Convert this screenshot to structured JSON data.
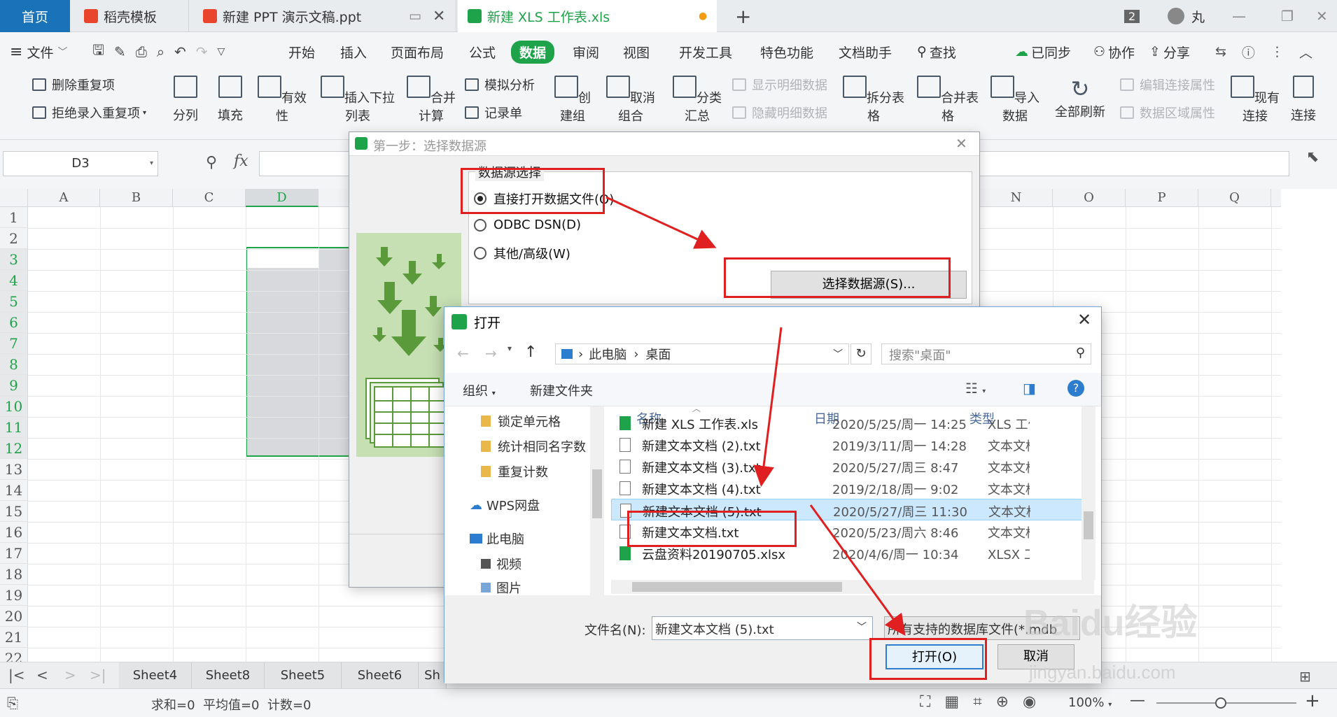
{
  "tabs": [
    {
      "label": "首页",
      "active": true
    },
    {
      "label": "稻壳模板"
    },
    {
      "label": "新建 PPT 演示文稿.ppt"
    },
    {
      "label": "新建 XLS 工作表.xls",
      "current": true
    }
  ],
  "titlebar": {
    "badge": "2",
    "user": "丸"
  },
  "menu": {
    "file": "文件",
    "items": [
      "开始",
      "插入",
      "页面布局",
      "公式",
      "数据",
      "审阅",
      "视图",
      "开发工具",
      "特色功能",
      "文档助手"
    ],
    "active": "数据",
    "search": "查找",
    "synced": "已同步",
    "collab": "协作",
    "share": "分享"
  },
  "ribbon": {
    "remove_dup": "删除重复项",
    "reject_dup": "拒绝录入重复项",
    "split": "分列",
    "fill": "填充",
    "validity": "有效性",
    "insert_dropdown": "插入下拉列表",
    "consolidate": "合并计算",
    "simulate": "模拟分析",
    "record": "记录单",
    "group": "创建组",
    "ungroup": "取消组合",
    "subtotal": "分类汇总",
    "show_detail": "显示明细数据",
    "hide_detail": "隐藏明细数据",
    "split_table": "拆分表格",
    "merge_table": "合并表格",
    "import": "导入数据",
    "refresh": "全部刷新",
    "edit_link": "编辑连接属性",
    "range_prop": "数据区域属性",
    "existing": "现有连接",
    "connect": "连接"
  },
  "formula": {
    "cell_ref": "D3",
    "fx": "fx"
  },
  "grid": {
    "columns": [
      "A",
      "B",
      "C",
      "D",
      "",
      "",
      "",
      "",
      "",
      "",
      "",
      "",
      "",
      "N",
      "O",
      "P",
      "Q"
    ],
    "rows": [
      "1",
      "2",
      "3",
      "4",
      "5",
      "6",
      "7",
      "8",
      "9",
      "10",
      "11",
      "12",
      "13",
      "14",
      "15",
      "16",
      "17",
      "18",
      "19",
      "20",
      "21",
      "22"
    ]
  },
  "sheets": [
    "Sheet4",
    "Sheet8",
    "Sheet5",
    "Sheet6",
    "Sh"
  ],
  "status": {
    "text": "求和=0  平均值=0  计数=0",
    "zoom": "100%"
  },
  "wizard": {
    "title": "第一步：选择数据源",
    "group_label": "数据源选择",
    "options": [
      "直接打开数据文件(O)",
      "ODBC DSN(D)",
      "其他/高级(W)"
    ],
    "choose_button": "选择数据源(S)..."
  },
  "open_dialog": {
    "title": "打开",
    "path": [
      "此电脑",
      "桌面"
    ],
    "search_placeholder": "搜索\"桌面\"",
    "organize": "组织",
    "new_folder": "新建文件夹",
    "nav_items": [
      "锁定单元格",
      "统计相同名字数据",
      "重复计数",
      "WPS网盘",
      "此电脑",
      "视频",
      "图片"
    ],
    "headers": {
      "name": "名称",
      "date": "日期",
      "type": "类型"
    },
    "files": [
      {
        "name": "新建 XLS 工作表.xls",
        "date": "2020/5/25/周一 14:25",
        "type": "XLS 工作"
      },
      {
        "name": "新建文本文档 (2).txt",
        "date": "2019/3/11/周一 14:28",
        "type": "文本文档"
      },
      {
        "name": "新建文本文档 (3).txt",
        "date": "2020/5/27/周三 8:47",
        "type": "文本文档"
      },
      {
        "name": "新建文本文档 (4).txt",
        "date": "2019/2/18/周一 9:02",
        "type": "文本文档"
      },
      {
        "name": "新建文本文档 (5).txt",
        "date": "2020/5/27/周三 11:30",
        "type": "文本文档",
        "selected": true
      },
      {
        "name": "新建文本文档.txt",
        "date": "2020/5/23/周六 8:46",
        "type": "文本文档"
      },
      {
        "name": "云盘资料20190705.xlsx",
        "date": "2020/4/6/周一 10:34",
        "type": "XLSX 工作"
      }
    ],
    "filename_label": "文件名(N):",
    "filename_value": "新建文本文档 (5).txt",
    "filetype": "所有支持的数据库文件(*.mdb",
    "open_button": "打开(O)",
    "cancel_button": "取消"
  },
  "watermark": {
    "brand": "Baidu经验",
    "url": "jingyan.baidu.com"
  },
  "colors": {
    "accent": "#1fa34a",
    "highlight_red": "#e02020",
    "selection": "#cce8ff"
  }
}
